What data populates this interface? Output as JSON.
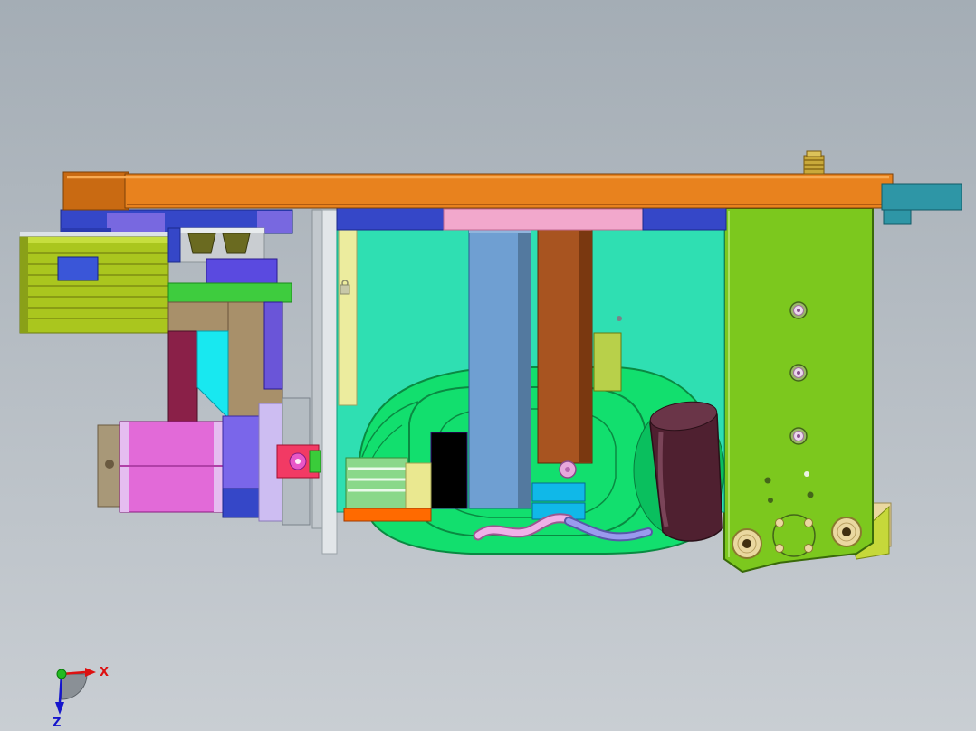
{
  "axis_triad": {
    "x_label": "X",
    "z_label": "Z"
  },
  "colors": {
    "background_top": "#a4adb5",
    "background_bottom": "#c9ced3",
    "top_plate": "#e8821e",
    "top_plate_shadow": "#c96a12",
    "teal_end_block": "#2e96a6",
    "gold_fitting": "#c9a93a",
    "blue_strip": "#3547c8",
    "purple_strip": "#7868e0",
    "pink_strip": "#f2a8cc",
    "chartreuse_block": "#aac61e",
    "connector_gray": "#c9cdd1",
    "olive_slot": "#6a6a20",
    "violet_block": "#5a4ae0",
    "green_bar": "#3ecc3e",
    "tan_bracket": "#a8906a",
    "maroon_slab": "#8a2048",
    "cyan_wedge": "#18e8f0",
    "cylinder_magenta": "#e26ad8",
    "cylinder_stripe": "#e5bdf0",
    "cap_tan": "#a89878",
    "violet_block2": "#7a66ea",
    "lavender_plate": "#cdbdf2",
    "gray_plate": "#b4bcc2",
    "pink_clamp": "#f23a64",
    "turquoise_body": "#2fdfb2",
    "pale_yellow_strip": "#ecec9e",
    "steel_column": "#6f9fd2",
    "brown_column": "#a85420",
    "yellow_green_block": "#b8d04a",
    "blob_green": "#12df6e",
    "contour_green": "#0a8a42",
    "tube_maroon": "#4f2030",
    "striped_green_block": "#8ad88a",
    "yellow_plate": "#eae890",
    "orange_bar": "#ff6a00",
    "cyan_block": "#10b8e8",
    "hose_pink": "#f0b0e8",
    "hose_violet": "#9a9aee",
    "right_plate": "#7cc81e",
    "washer_cream": "#ead8a0",
    "axis_x": "#dd1111",
    "axis_z": "#1515cc",
    "axis_origin": "#22bb22",
    "axis_wedge": "#8a9096"
  }
}
